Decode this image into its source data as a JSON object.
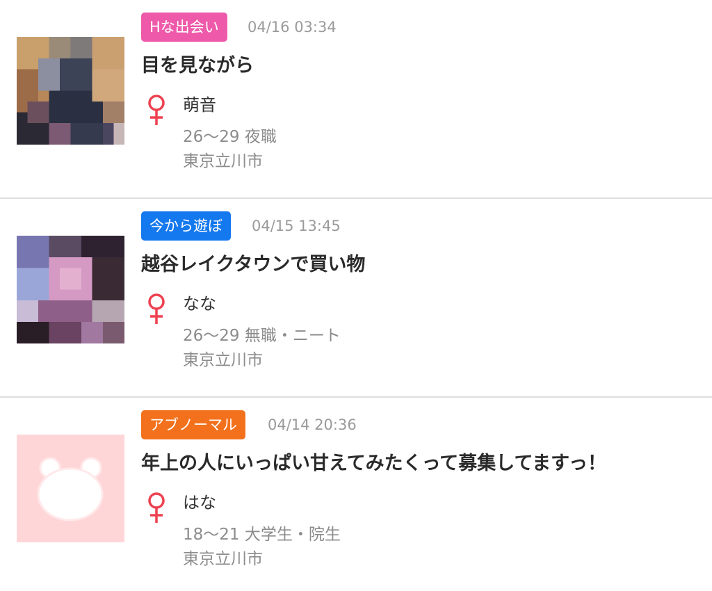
{
  "colors": {
    "tag_pink": "#ee5aa9",
    "tag_blue": "#1478ee",
    "tag_orange": "#f3711d",
    "female_symbol": "#ee4150",
    "placeholder_bg": "#ffd6d8"
  },
  "posts": [
    {
      "category": "Hな出会い",
      "datetime": "04/16 03:34",
      "title": "目を見ながら",
      "gender_icon": "female-icon",
      "name": "萌音",
      "profile": "26〜29 夜職",
      "location": "東京立川市",
      "avatar": "blurred-photo"
    },
    {
      "category": "今から遊ぼ",
      "datetime": "04/15 13:45",
      "title": "越谷レイクタウンで買い物",
      "gender_icon": "female-icon",
      "name": "なな",
      "profile": "26〜29 無職・ニート",
      "location": "東京立川市",
      "avatar": "blurred-photo"
    },
    {
      "category": "アブノーマル",
      "datetime": "04/14 20:36",
      "title": "年上の人にいっぱい甘えてみたくって募集してますっ！",
      "gender_icon": "female-icon",
      "name": "はな",
      "profile": "18〜21 大学生・院生",
      "location": "東京立川市",
      "avatar": "bear-placeholder-icon"
    }
  ]
}
